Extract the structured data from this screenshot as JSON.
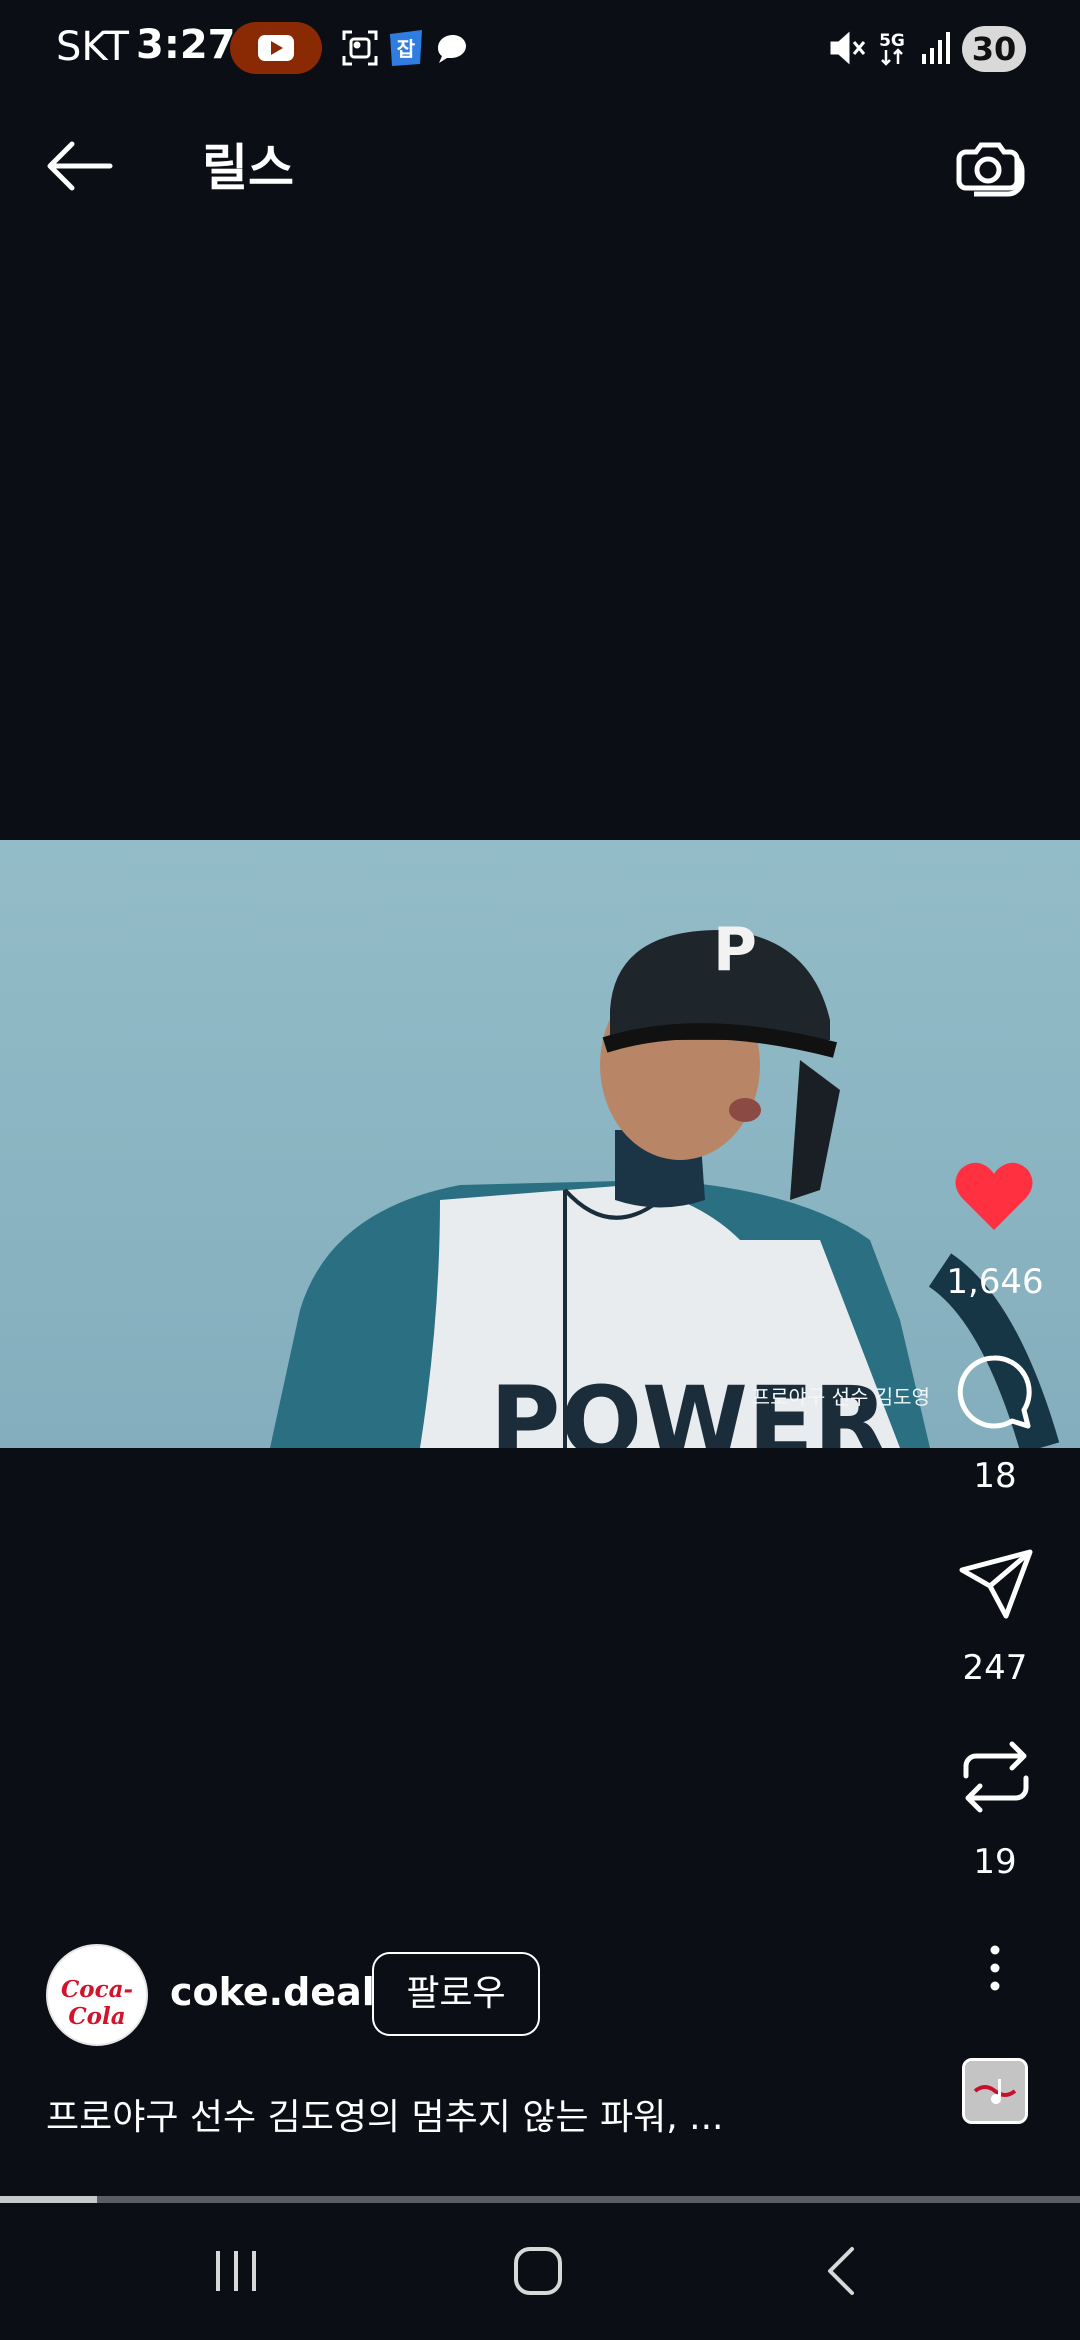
{
  "status_bar": {
    "carrier": "SKT",
    "time": "3:27",
    "network": "5G",
    "battery": "30"
  },
  "header": {
    "title": "릴스"
  },
  "video": {
    "watermark": "프로야구 선수 김도영",
    "helmet_letter": "P",
    "jersey_text": "POWER"
  },
  "actions": {
    "likes": "1,646",
    "comments": "18",
    "shares": "247",
    "reposts": "19"
  },
  "post": {
    "avatar_text": "Coca-Cola",
    "username": "coke.deal",
    "follow_label": "팔로우",
    "caption": "프로야구 선수 김도영의 멈추지 않는 파워, ..."
  },
  "progress": 0.09,
  "colors": {
    "background": "#0b0e14",
    "like": "#ff3040",
    "youtube_pill": "#8a2a04",
    "sky": "#8fb7c4"
  },
  "icons": [
    "back-arrow-icon",
    "camera-icon",
    "heart-icon",
    "comment-icon",
    "send-icon",
    "repost-icon",
    "more-icon",
    "music-icon",
    "recent-apps-icon",
    "home-icon",
    "nav-back-icon"
  ]
}
